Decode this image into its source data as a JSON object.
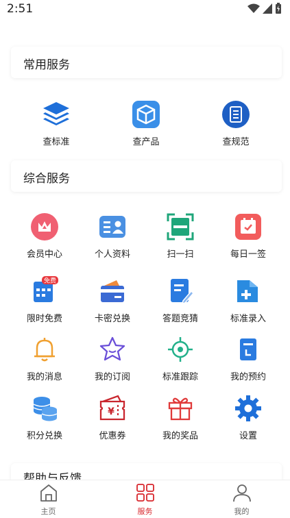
{
  "status": {
    "time": "2:51"
  },
  "common_services": {
    "title": "常用服务",
    "items": [
      {
        "label": "查标准",
        "icon": "layers-icon"
      },
      {
        "label": "查产品",
        "icon": "box-icon"
      },
      {
        "label": "查规范",
        "icon": "document-list-icon"
      }
    ]
  },
  "general_services": {
    "title": "综合服务",
    "rows": [
      [
        {
          "label": "会员中心",
          "icon": "crown-icon"
        },
        {
          "label": "个人资料",
          "icon": "id-card-icon"
        },
        {
          "label": "扫一扫",
          "icon": "scan-icon"
        },
        {
          "label": "每日一签",
          "icon": "calendar-icon"
        }
      ],
      [
        {
          "label": "限时免费",
          "icon": "free-calendar-icon",
          "badge": "免费"
        },
        {
          "label": "卡密兑换",
          "icon": "card-icon"
        },
        {
          "label": "答题竞猜",
          "icon": "quiz-icon"
        },
        {
          "label": "标准录入",
          "icon": "folder-add-icon"
        }
      ],
      [
        {
          "label": "我的消息",
          "icon": "bell-icon"
        },
        {
          "label": "我的订阅",
          "icon": "star-icon"
        },
        {
          "label": "标准跟踪",
          "icon": "target-icon"
        },
        {
          "label": "我的预约",
          "icon": "reservation-icon"
        }
      ],
      [
        {
          "label": "积分兑换",
          "icon": "coins-icon"
        },
        {
          "label": "优惠券",
          "icon": "coupon-icon"
        },
        {
          "label": "我的奖品",
          "icon": "gift-icon"
        },
        {
          "label": "设置",
          "icon": "gear-icon"
        }
      ]
    ]
  },
  "help": {
    "title": "帮助与反馈"
  },
  "bottom_nav": [
    {
      "label": "主页",
      "icon": "home-icon",
      "active": false
    },
    {
      "label": "服务",
      "icon": "grid-icon",
      "active": true
    },
    {
      "label": "我的",
      "icon": "person-icon",
      "active": false
    }
  ],
  "colors": {
    "accent": "#d8262c",
    "blue": "#1e6fd9"
  }
}
